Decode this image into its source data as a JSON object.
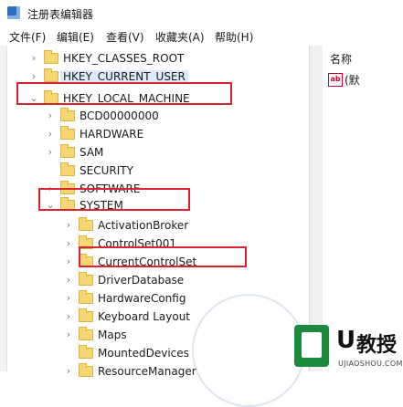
{
  "window": {
    "title": "注册表编辑器",
    "icon": "registry-editor-icon"
  },
  "menu": [
    "文件(F)",
    "编辑(E)",
    "查看(V)",
    "收藏夹(A)",
    "帮助(H)"
  ],
  "tree": [
    {
      "label": "HKEY_CLASSES_ROOT",
      "expander": ">",
      "icon": "folder-icon"
    },
    {
      "label": "HKEY_CURRENT_USER",
      "expander": ">",
      "icon": "folder-icon"
    },
    {
      "label": "HKEY_LOCAL_MACHINE",
      "expander": "v",
      "icon": "folder-icon"
    },
    {
      "label": "BCD00000000",
      "expander": ">",
      "icon": "folder-icon"
    },
    {
      "label": "HARDWARE",
      "expander": ">",
      "icon": "folder-icon"
    },
    {
      "label": "SAM",
      "expander": ">",
      "icon": "folder-icon"
    },
    {
      "label": "SECURITY",
      "expander": "",
      "icon": "folder-icon"
    },
    {
      "label": "SOFTWARE",
      "expander": ">",
      "icon": "folder-icon"
    },
    {
      "label": "SYSTEM",
      "expander": "v",
      "icon": "folder-icon"
    },
    {
      "label": "ActivationBroker",
      "expander": ">",
      "icon": "folder-icon"
    },
    {
      "label": "ControlSet001",
      "expander": ">",
      "icon": "folder-icon"
    },
    {
      "label": "CurrentControlSet",
      "expander": ">",
      "icon": "folder-icon"
    },
    {
      "label": "DriverDatabase",
      "expander": ">",
      "icon": "folder-icon"
    },
    {
      "label": "HardwareConfig",
      "expander": ">",
      "icon": "folder-icon"
    },
    {
      "label": "Keyboard Layout",
      "expander": ">",
      "icon": "folder-icon"
    },
    {
      "label": "Maps",
      "expander": ">",
      "icon": "folder-icon"
    },
    {
      "label": "MountedDevices",
      "expander": "",
      "icon": "folder-icon"
    },
    {
      "label": "ResourceManager",
      "expander": ">",
      "icon": "folder-icon"
    }
  ],
  "values_pane": {
    "column_header": "名称",
    "first_value": "(默",
    "value_icon": "string-value-icon",
    "value_icon_text": "ab"
  },
  "watermark": {
    "brand": "教授",
    "letter": "U",
    "url": "UJIAOSHOU.COM"
  },
  "colors": {
    "highlight_box": "#d9232e",
    "selection": "#dbeafc",
    "folder": "#f7d673"
  }
}
